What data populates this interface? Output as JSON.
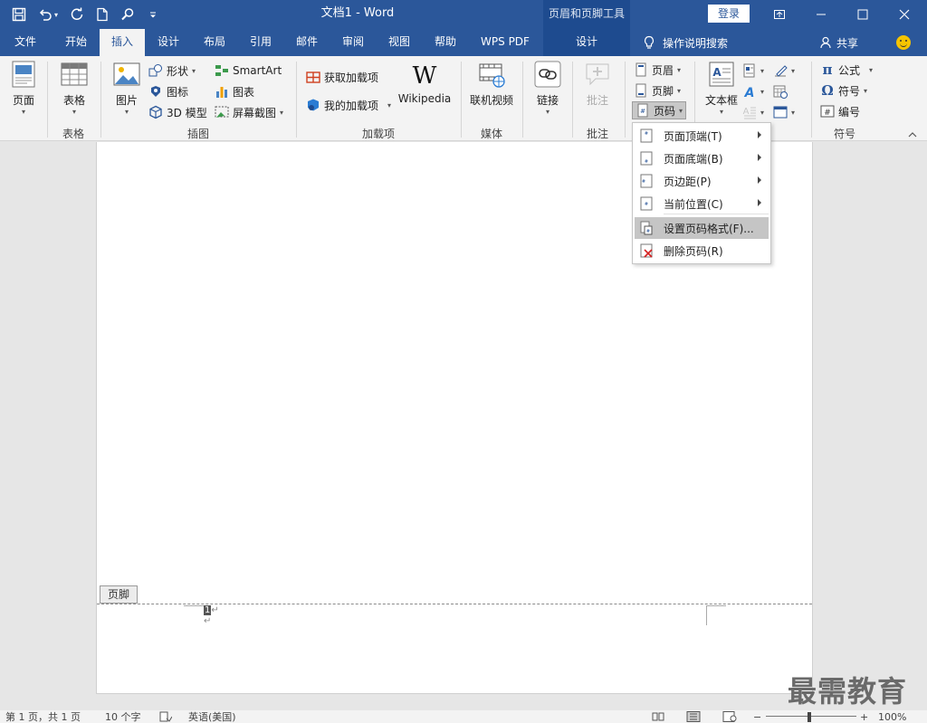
{
  "window": {
    "title": "文档1  -  Word",
    "context_tool_title": "页眉和页脚工具",
    "login_label": "登录"
  },
  "tabs": {
    "file": "文件",
    "home": "开始",
    "insert": "插入",
    "design": "设计",
    "layout": "布局",
    "references": "引用",
    "mailings": "邮件",
    "review": "审阅",
    "view": "视图",
    "help": "帮助",
    "wps_pdf": "WPS PDF",
    "hf_design": "设计",
    "tell_me": "操作说明搜索",
    "share": "共享"
  },
  "ribbon": {
    "pages": {
      "btn": "页面"
    },
    "tables": {
      "btn": "表格",
      "group": "表格"
    },
    "illustrations": {
      "pictures": "图片",
      "shapes": "形状",
      "icons": "图标",
      "model3d": "3D 模型",
      "smartart": "SmartArt",
      "chart": "图表",
      "screenshot": "屏幕截图",
      "group": "插图"
    },
    "addins": {
      "get": "获取加载项",
      "mine": "我的加载项",
      "wikipedia": "Wikipedia",
      "group": "加载项"
    },
    "media": {
      "online_video": "联机视频",
      "group": "媒体"
    },
    "links": {
      "link": "链接"
    },
    "comments": {
      "comment": "批注",
      "group": "批注"
    },
    "header_footer": {
      "header": "页眉",
      "footer": "页脚",
      "page_number": "页码"
    },
    "text": {
      "textbox": "文本框"
    },
    "symbols": {
      "equation": "公式",
      "symbol": "符号",
      "numbering": "编号",
      "group": "符号"
    }
  },
  "page_number_menu": {
    "items": [
      {
        "label": "页面顶端(T)",
        "submenu": true
      },
      {
        "label": "页面底端(B)",
        "submenu": true
      },
      {
        "label": "页边距(P)",
        "submenu": true
      },
      {
        "label": "当前位置(C)",
        "submenu": true
      },
      {
        "label": "设置页码格式(F)...",
        "submenu": false
      },
      {
        "label": "删除页码(R)",
        "submenu": false
      }
    ]
  },
  "document": {
    "footer_tag": "页脚",
    "page_number_field": "1",
    "para_mark": "↵"
  },
  "watermark": "最需教育",
  "statusbar": {
    "page": "第 1 页，共 1 页",
    "words": "10 个字",
    "language": "英语(美国)",
    "zoom": "100%"
  },
  "colors": {
    "title_blue": "#2b579a",
    "context_blue": "#1e4b8f",
    "ribbon_bg": "#f3f3f3",
    "menu_highlight": "#c5c5c5"
  }
}
